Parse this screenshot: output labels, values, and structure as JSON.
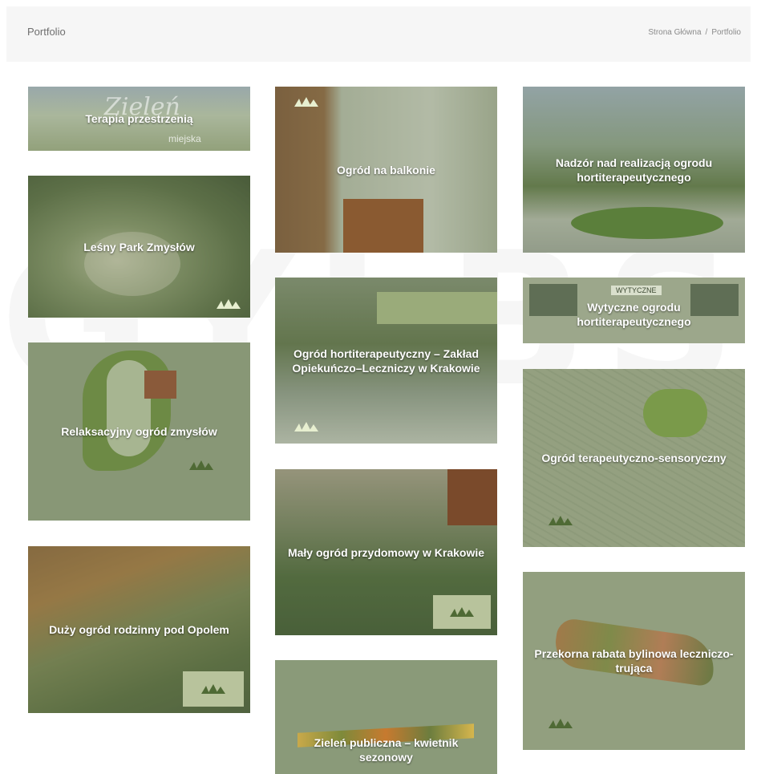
{
  "header": {
    "title": "Portfolio",
    "breadcrumb": {
      "home": "Strona Główna",
      "separator": "/",
      "current": "Portfolio"
    }
  },
  "portfolio": [
    {
      "title": "Terapia przestrzenią"
    },
    {
      "title": "Leśny Park Zmysłów"
    },
    {
      "title": "Relaksacyjny ogród zmysłów"
    },
    {
      "title": "Duży ogród rodzinny pod Opolem"
    },
    {
      "title": "Ogród na balkonie"
    },
    {
      "title": "Ogród hortiterapeutyczny – Zakład Opiekuńczo–Leczniczy w Krakowie"
    },
    {
      "title": "Mały ogród przydomowy w Krakowie"
    },
    {
      "title": "Zieleń publiczna – kwietnik sezonowy"
    },
    {
      "title": "Nadzór nad realizacją ogrodu hortiterapeutycznego"
    },
    {
      "title": "Wytyczne ogrodu hortiterapeutycznego"
    },
    {
      "title": "Ogród terapeutyczno-sensoryczny"
    },
    {
      "title": "Przekorna rabata bylinowa leczniczo-trująca"
    }
  ],
  "image_text": {
    "card1": {
      "logo_big": "Zieleń",
      "logo_small": "miejska"
    },
    "card10": {
      "label": "WYTYCZNE"
    }
  },
  "watermark": "GYLBS",
  "colors": {
    "overlay": "#7a8a68",
    "header_bg": "#f6f6f6"
  }
}
